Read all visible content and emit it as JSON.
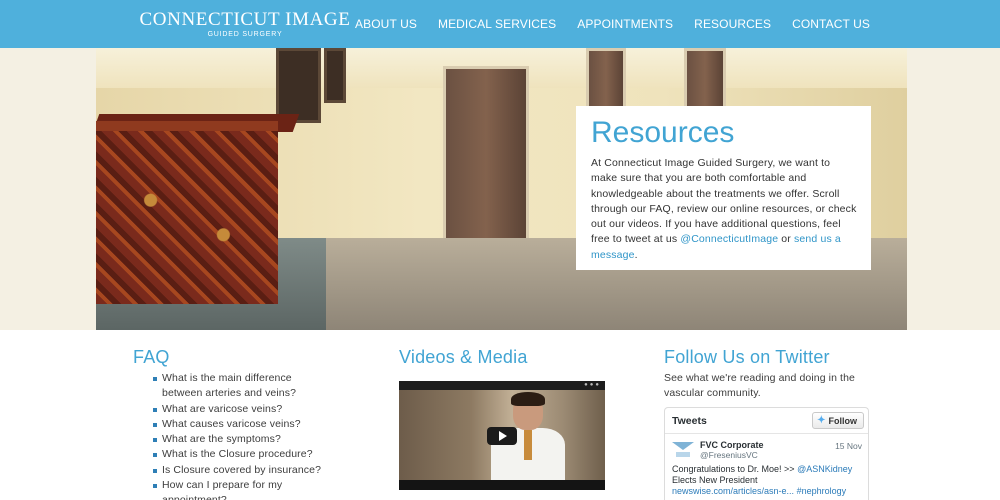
{
  "header": {
    "logo_main": "CONNECTICUT IMAGE",
    "logo_sub": "GUIDED SURGERY",
    "nav": [
      "ABOUT US",
      "MEDICAL SERVICES",
      "APPOINTMENTS",
      "RESOURCES",
      "CONTACT US"
    ]
  },
  "hero": {
    "title": "Resources",
    "text_before": "At Connecticut Image Guided Surgery, we want to make sure that you are both comfortable and knowledgeable about the treatments we offer. Scroll through our FAQ, review our online resources, or check out our videos. If you have additional questions, feel free to tweet at us ",
    "twitter_link": "@ConnecticutImage",
    "text_mid": " or ",
    "message_link": "send us a message",
    "text_after": "."
  },
  "faq": {
    "title": "FAQ",
    "items": [
      "What is the main difference between arteries and veins?",
      "What are varicose veins?",
      "What causes varicose veins?",
      "What are the symptoms?",
      "What is the Closure procedure?",
      "Is Closure covered by insurance?",
      "How can I prepare for my appointment?"
    ]
  },
  "videos": {
    "title": "Videos & Media"
  },
  "twitter": {
    "title": "Follow Us on Twitter",
    "subtitle": "See what we're reading and doing in the vascular community.",
    "widget_title": "Tweets",
    "follow_label": "Follow",
    "tweet": {
      "author": "FVC Corporate",
      "handle": "@FreseniusVC",
      "date": "15 Nov",
      "text_before": "Congratulations to Dr. Moe! >> ",
      "mention": "@ASNKidney",
      "text_mid": " Elects New President ",
      "link": "newswise.com/articles/asn-e...",
      "hashtag": "#nephrology"
    }
  },
  "colors": {
    "header_bg": "#4fb0dc",
    "accent": "#41a4d3",
    "link": "#2f95c8"
  }
}
